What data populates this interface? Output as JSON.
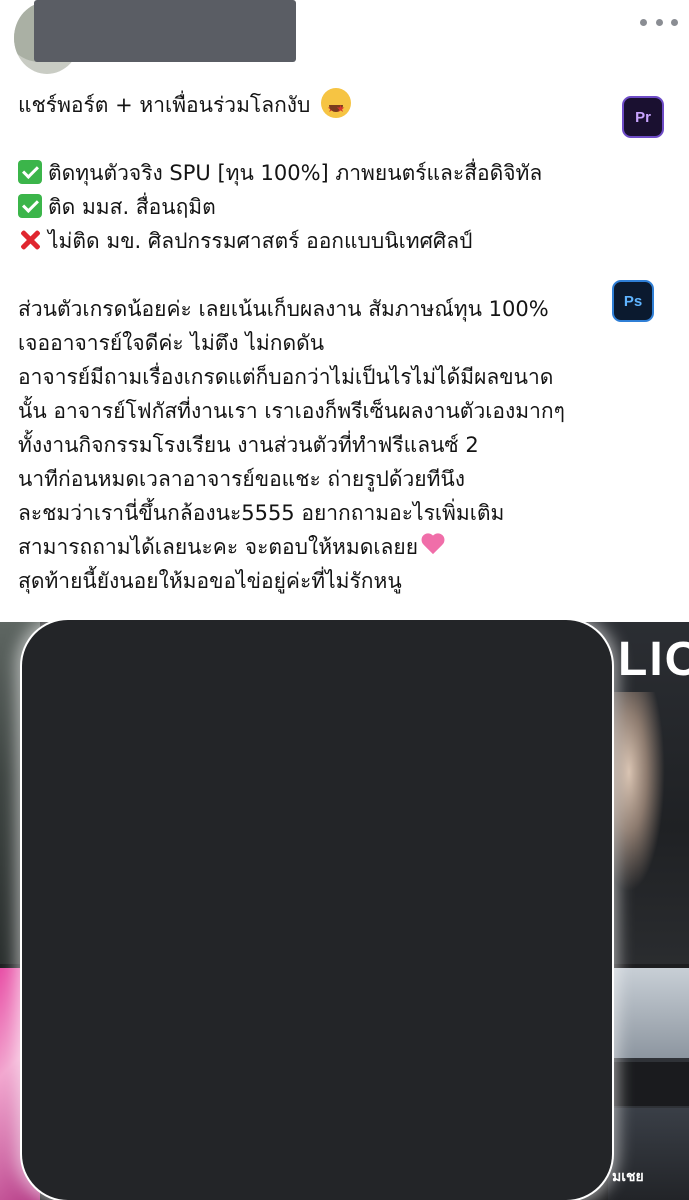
{
  "post": {
    "title_line": "แชร์พอร์ต + หาเพื่อนร่วมโลกงับ",
    "results": [
      {
        "status": "check",
        "text": "ติดทุนตัวจริง SPU [ทุน 100%] ภาพยนตร์และสื่อดิจิทัล"
      },
      {
        "status": "check",
        "text": "ติด มมส. สื่อนฤมิต"
      },
      {
        "status": "cross",
        "text": "ไม่ติด มข. ศิลปกรรมศาสตร์ ออกแบบนิเทศศิลป์"
      }
    ],
    "body_lines": [
      "ส่วนตัวเกรดน้อยค่ะ เลยเน้นเก็บผลงาน สัมภาษณ์ทุน 100%",
      "เจออาจารย์ใจดีค่ะ ไม่ตึง ไม่กดดัน",
      "อาจารย์มีถามเรื่องเกรดแต่ก็บอกว่าไม่เป็นไรไม่ได้มีผลขนาด",
      "นั้น อาจารย์โฟกัสที่งานเรา เราเองก็พรีเซ็นผลงานตัวเองมากๆ",
      "ทั้งงานกิจกรรมโรงเรียน งานส่วนตัวที่ทำฟรีแลนซ์ 2",
      "นาทีก่อนหมดเวลาอาจารย์ขอแชะ ถ่ายรูปด้วยทีนึง",
      "ละชมว่าเรานี่ขึ้นกล้องนะ5555 อยากถามอะไรเพิ่มเติม",
      "สามารถถามได้เลยนะคะ จะตอบให้หมดเลยย",
      "สุดท้ายนี้ยังนอยให้มอขอไข่อยู่ค่ะที่ไม่รักหนู"
    ]
  },
  "gallery": {
    "portfolio_title_fragment": "LIO",
    "app_badges": [
      "Pr",
      "Ps"
    ],
    "caption_fragment": "มเชย"
  },
  "icons": {
    "title_emoji": "star-struck-face-icon",
    "check": "check-mark-icon",
    "cross": "cross-mark-icon",
    "heart": "pink-heart-icon",
    "more": "more-options-icon"
  },
  "colors": {
    "check": "#3bb54a",
    "cross": "#e0262f",
    "heart": "#f06ea9",
    "redaction": "#232528"
  }
}
